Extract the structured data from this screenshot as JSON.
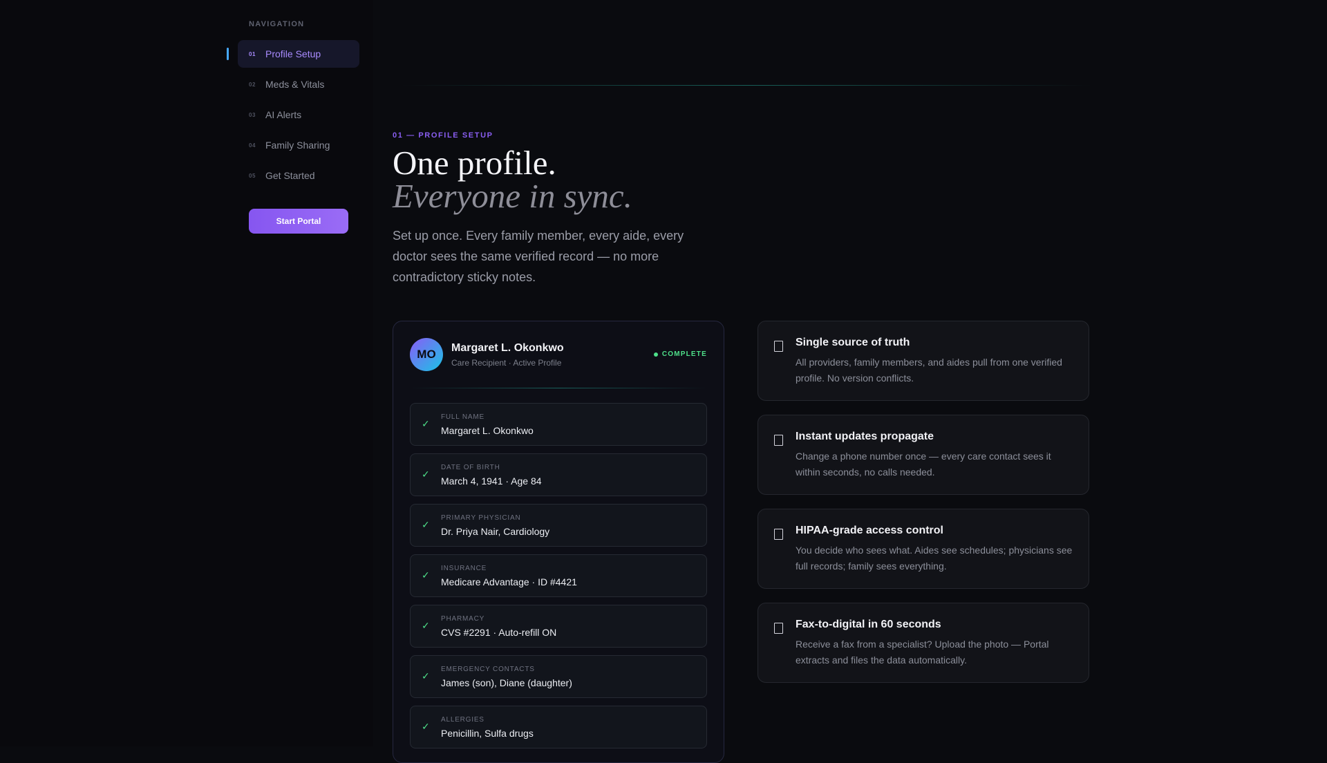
{
  "sidebar": {
    "heading": "NAVIGATION",
    "items": [
      {
        "num": "01",
        "label": "Profile Setup",
        "active": true
      },
      {
        "num": "02",
        "label": "Meds & Vitals",
        "active": false
      },
      {
        "num": "03",
        "label": "AI Alerts",
        "active": false
      },
      {
        "num": "04",
        "label": "Family Sharing",
        "active": false
      },
      {
        "num": "05",
        "label": "Get Started",
        "active": false
      }
    ],
    "cta_label": "Start Portal"
  },
  "main": {
    "section_label": "01 — PROFILE SETUP",
    "title_line1": "One profile.",
    "title_line2": "Everyone in sync.",
    "description": "Set up once. Every family member, every aide, every doctor sees the same verified record — no more contradictory sticky notes."
  },
  "profile": {
    "initials": "MO",
    "name": "Margaret L. Okonkwo",
    "subtitle": "Care Recipient · Active Profile",
    "status": "COMPLETE",
    "fields": [
      {
        "label": "FULL NAME",
        "value": "Margaret L. Okonkwo"
      },
      {
        "label": "DATE OF BIRTH",
        "value": "March 4, 1941 · Age 84"
      },
      {
        "label": "PRIMARY PHYSICIAN",
        "value": "Dr. Priya Nair, Cardiology"
      },
      {
        "label": "INSURANCE",
        "value": "Medicare Advantage · ID #4421"
      },
      {
        "label": "PHARMACY",
        "value": "CVS #2291 · Auto-refill ON"
      },
      {
        "label": "EMERGENCY CONTACTS",
        "value": "James (son), Diane (daughter)"
      },
      {
        "label": "ALLERGIES",
        "value": "Penicillin, Sulfa drugs"
      }
    ]
  },
  "features": [
    {
      "icon": "document-icon",
      "title": "Single source of truth",
      "description": "All providers, family members, and aides pull from one verified profile. No version conflicts."
    },
    {
      "icon": "document-icon",
      "title": "Instant updates propagate",
      "description": "Change a phone number once — every care contact sees it within seconds, no calls needed."
    },
    {
      "icon": "document-icon",
      "title": "HIPAA-grade access control",
      "description": "You decide who sees what. Aides see schedules; physicians see full records; family sees everything."
    },
    {
      "icon": "document-icon",
      "title": "Fax-to-digital in 60 seconds",
      "description": "Receive a fax from a specialist? Upload the photo — Portal extracts and files the data automatically."
    }
  ],
  "colors": {
    "accent": "#8a5ef2",
    "active_bar": "#46a8ff",
    "success": "#4ee08a",
    "background": "#0a0b0f"
  }
}
